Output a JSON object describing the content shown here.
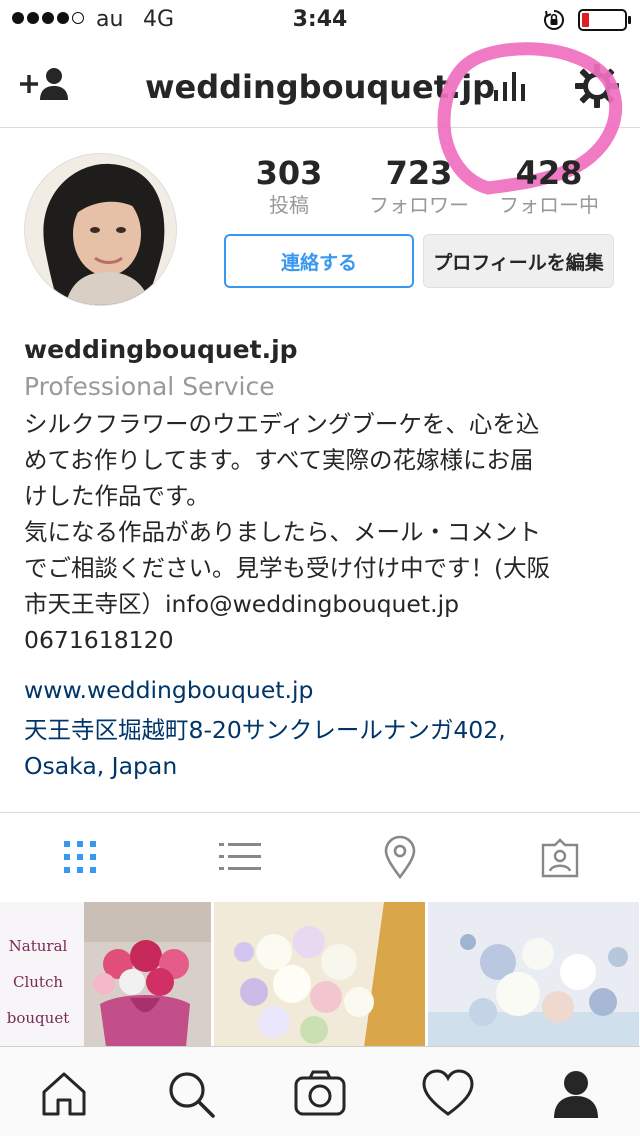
{
  "status_bar": {
    "carrier": "au",
    "network": "4G",
    "time": "3:44"
  },
  "nav": {
    "title": "weddingbouquet.jp",
    "icons": [
      "add-user-icon",
      "insights-bar-chart-icon",
      "gear-icon"
    ]
  },
  "profile": {
    "stats": [
      {
        "value": "303",
        "label": "投稿"
      },
      {
        "value": "723",
        "label": "フォロワー"
      },
      {
        "value": "428",
        "label": "フォロー中"
      }
    ],
    "contact_label": "連絡する",
    "edit_label": "プロフィールを編集"
  },
  "bio": {
    "username": "weddingbouquet.jp",
    "category": "Professional Service",
    "description_lines": [
      "シルクフラワーのウエディングブーケを、心を込",
      "めてお作りしてます。すべて実際の花嫁様にお届",
      "けした作品です。",
      "気になる作品がありましたら、メール・コメント",
      "でご相談ください。見学も受け付け中です！(大阪",
      "市天王寺区）info@weddingbouquet.jp",
      "0671618120"
    ],
    "website": "www.weddingbouquet.jp",
    "address_lines": [
      "天王寺区堀越町8-20サンクレールナンガ402,",
      "Osaka, Japan"
    ]
  },
  "tabs": [
    "grid-icon",
    "list-icon",
    "location-pin-icon",
    "tagged-photos-icon"
  ],
  "grid": {
    "first_tile_text": [
      "Natural",
      "Clutch",
      "bouquet"
    ]
  },
  "bottom_nav": [
    "home-icon",
    "search-icon",
    "camera-icon",
    "heart-icon",
    "profile-icon"
  ],
  "colors": {
    "accent_blue": "#3897f0",
    "link_blue": "#003569",
    "annotation_pink": "#f06fc0"
  }
}
